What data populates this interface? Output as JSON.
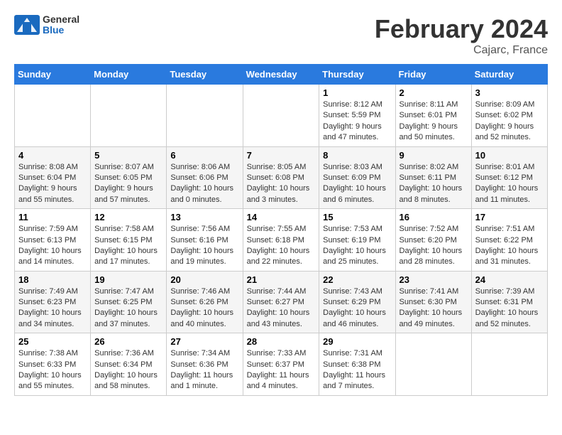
{
  "logo": {
    "general": "General",
    "blue": "Blue"
  },
  "title": "February 2024",
  "location": "Cajarc, France",
  "days_of_week": [
    "Sunday",
    "Monday",
    "Tuesday",
    "Wednesday",
    "Thursday",
    "Friday",
    "Saturday"
  ],
  "weeks": [
    [
      {
        "day": "",
        "info": ""
      },
      {
        "day": "",
        "info": ""
      },
      {
        "day": "",
        "info": ""
      },
      {
        "day": "",
        "info": ""
      },
      {
        "day": "1",
        "info": "Sunrise: 8:12 AM\nSunset: 5:59 PM\nDaylight: 9 hours and 47 minutes."
      },
      {
        "day": "2",
        "info": "Sunrise: 8:11 AM\nSunset: 6:01 PM\nDaylight: 9 hours and 50 minutes."
      },
      {
        "day": "3",
        "info": "Sunrise: 8:09 AM\nSunset: 6:02 PM\nDaylight: 9 hours and 52 minutes."
      }
    ],
    [
      {
        "day": "4",
        "info": "Sunrise: 8:08 AM\nSunset: 6:04 PM\nDaylight: 9 hours and 55 minutes."
      },
      {
        "day": "5",
        "info": "Sunrise: 8:07 AM\nSunset: 6:05 PM\nDaylight: 9 hours and 57 minutes."
      },
      {
        "day": "6",
        "info": "Sunrise: 8:06 AM\nSunset: 6:06 PM\nDaylight: 10 hours and 0 minutes."
      },
      {
        "day": "7",
        "info": "Sunrise: 8:05 AM\nSunset: 6:08 PM\nDaylight: 10 hours and 3 minutes."
      },
      {
        "day": "8",
        "info": "Sunrise: 8:03 AM\nSunset: 6:09 PM\nDaylight: 10 hours and 6 minutes."
      },
      {
        "day": "9",
        "info": "Sunrise: 8:02 AM\nSunset: 6:11 PM\nDaylight: 10 hours and 8 minutes."
      },
      {
        "day": "10",
        "info": "Sunrise: 8:01 AM\nSunset: 6:12 PM\nDaylight: 10 hours and 11 minutes."
      }
    ],
    [
      {
        "day": "11",
        "info": "Sunrise: 7:59 AM\nSunset: 6:13 PM\nDaylight: 10 hours and 14 minutes."
      },
      {
        "day": "12",
        "info": "Sunrise: 7:58 AM\nSunset: 6:15 PM\nDaylight: 10 hours and 17 minutes."
      },
      {
        "day": "13",
        "info": "Sunrise: 7:56 AM\nSunset: 6:16 PM\nDaylight: 10 hours and 19 minutes."
      },
      {
        "day": "14",
        "info": "Sunrise: 7:55 AM\nSunset: 6:18 PM\nDaylight: 10 hours and 22 minutes."
      },
      {
        "day": "15",
        "info": "Sunrise: 7:53 AM\nSunset: 6:19 PM\nDaylight: 10 hours and 25 minutes."
      },
      {
        "day": "16",
        "info": "Sunrise: 7:52 AM\nSunset: 6:20 PM\nDaylight: 10 hours and 28 minutes."
      },
      {
        "day": "17",
        "info": "Sunrise: 7:51 AM\nSunset: 6:22 PM\nDaylight: 10 hours and 31 minutes."
      }
    ],
    [
      {
        "day": "18",
        "info": "Sunrise: 7:49 AM\nSunset: 6:23 PM\nDaylight: 10 hours and 34 minutes."
      },
      {
        "day": "19",
        "info": "Sunrise: 7:47 AM\nSunset: 6:25 PM\nDaylight: 10 hours and 37 minutes."
      },
      {
        "day": "20",
        "info": "Sunrise: 7:46 AM\nSunset: 6:26 PM\nDaylight: 10 hours and 40 minutes."
      },
      {
        "day": "21",
        "info": "Sunrise: 7:44 AM\nSunset: 6:27 PM\nDaylight: 10 hours and 43 minutes."
      },
      {
        "day": "22",
        "info": "Sunrise: 7:43 AM\nSunset: 6:29 PM\nDaylight: 10 hours and 46 minutes."
      },
      {
        "day": "23",
        "info": "Sunrise: 7:41 AM\nSunset: 6:30 PM\nDaylight: 10 hours and 49 minutes."
      },
      {
        "day": "24",
        "info": "Sunrise: 7:39 AM\nSunset: 6:31 PM\nDaylight: 10 hours and 52 minutes."
      }
    ],
    [
      {
        "day": "25",
        "info": "Sunrise: 7:38 AM\nSunset: 6:33 PM\nDaylight: 10 hours and 55 minutes."
      },
      {
        "day": "26",
        "info": "Sunrise: 7:36 AM\nSunset: 6:34 PM\nDaylight: 10 hours and 58 minutes."
      },
      {
        "day": "27",
        "info": "Sunrise: 7:34 AM\nSunset: 6:36 PM\nDaylight: 11 hours and 1 minute."
      },
      {
        "day": "28",
        "info": "Sunrise: 7:33 AM\nSunset: 6:37 PM\nDaylight: 11 hours and 4 minutes."
      },
      {
        "day": "29",
        "info": "Sunrise: 7:31 AM\nSunset: 6:38 PM\nDaylight: 11 hours and 7 minutes."
      },
      {
        "day": "",
        "info": ""
      },
      {
        "day": "",
        "info": ""
      }
    ]
  ]
}
